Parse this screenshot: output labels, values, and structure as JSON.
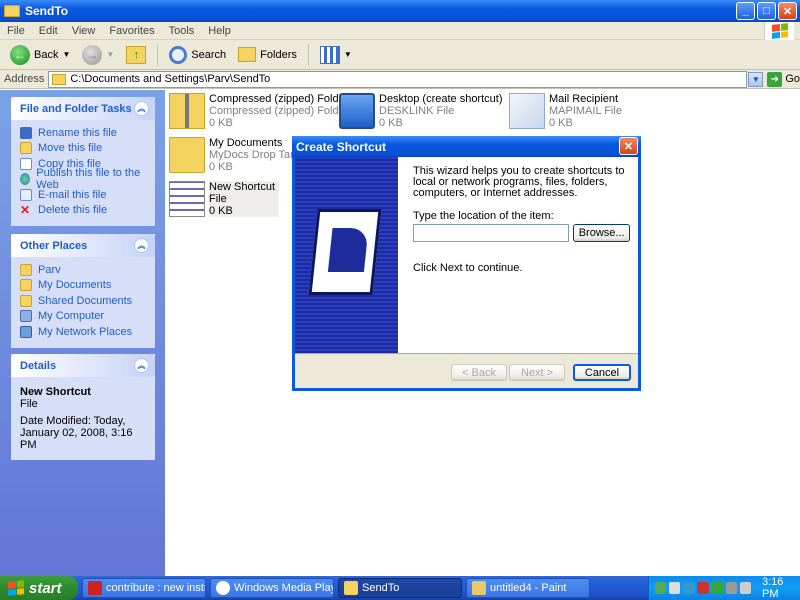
{
  "window": {
    "title": "SendTo"
  },
  "menu": [
    "File",
    "Edit",
    "View",
    "Favorites",
    "Tools",
    "Help"
  ],
  "toolbar": {
    "back": "Back",
    "search": "Search",
    "folders": "Folders"
  },
  "address": {
    "label": "Address",
    "path": "C:\\Documents and Settings\\Parv\\SendTo",
    "go": "Go"
  },
  "tasks": {
    "title": "File and Folder Tasks",
    "items": [
      {
        "label": "Rename this file",
        "icon": "rename-icon"
      },
      {
        "label": "Move this file",
        "icon": "move-icon"
      },
      {
        "label": "Copy this file",
        "icon": "copy-icon"
      },
      {
        "label": "Publish this file to the Web",
        "icon": "globe-icon"
      },
      {
        "label": "E-mail this file",
        "icon": "email-icon"
      },
      {
        "label": "Delete this file",
        "icon": "delete-icon"
      }
    ]
  },
  "places": {
    "title": "Other Places",
    "items": [
      {
        "label": "Parv",
        "icon": "folder-icon"
      },
      {
        "label": "My Documents",
        "icon": "folder-icon"
      },
      {
        "label": "Shared Documents",
        "icon": "folder-icon"
      },
      {
        "label": "My Computer",
        "icon": "computer-icon"
      },
      {
        "label": "My Network Places",
        "icon": "network-icon"
      }
    ]
  },
  "details": {
    "title": "Details",
    "name": "New Shortcut",
    "type": "File",
    "modified": "Date Modified: Today, January 02, 2008, 3:16 PM"
  },
  "files": [
    {
      "name": "Compressed (zipped) Folder",
      "type": "Compressed (zipped) Folder S...",
      "size": "0 KB"
    },
    {
      "name": "Desktop (create shortcut)",
      "type": "DESKLINK File",
      "size": "0 KB"
    },
    {
      "name": "Mail Recipient",
      "type": "MAPIMAIL File",
      "size": "0 KB"
    },
    {
      "name": "My Documents",
      "type": "MyDocs Drop Target",
      "size": "0 KB"
    },
    {
      "name": "New Shortcut",
      "type": "File",
      "size": "0 KB"
    }
  ],
  "dialog": {
    "title": "Create Shortcut",
    "intro": "This wizard helps you to create shortcuts to local or network programs, files, folders, computers, or Internet addresses.",
    "location_label": "Type the location of the item:",
    "location_value": "",
    "browse": "Browse...",
    "next_hint": "Click Next to continue.",
    "back": "< Back",
    "next": "Next >",
    "cancel": "Cancel"
  },
  "taskbar": {
    "start": "start",
    "tasks": [
      {
        "label": "contribute : new instr...",
        "active": false
      },
      {
        "label": "Windows Media Player",
        "active": false
      },
      {
        "label": "SendTo",
        "active": true
      },
      {
        "label": "untitled4 - Paint",
        "active": false
      }
    ],
    "clock": "3:16 PM"
  }
}
